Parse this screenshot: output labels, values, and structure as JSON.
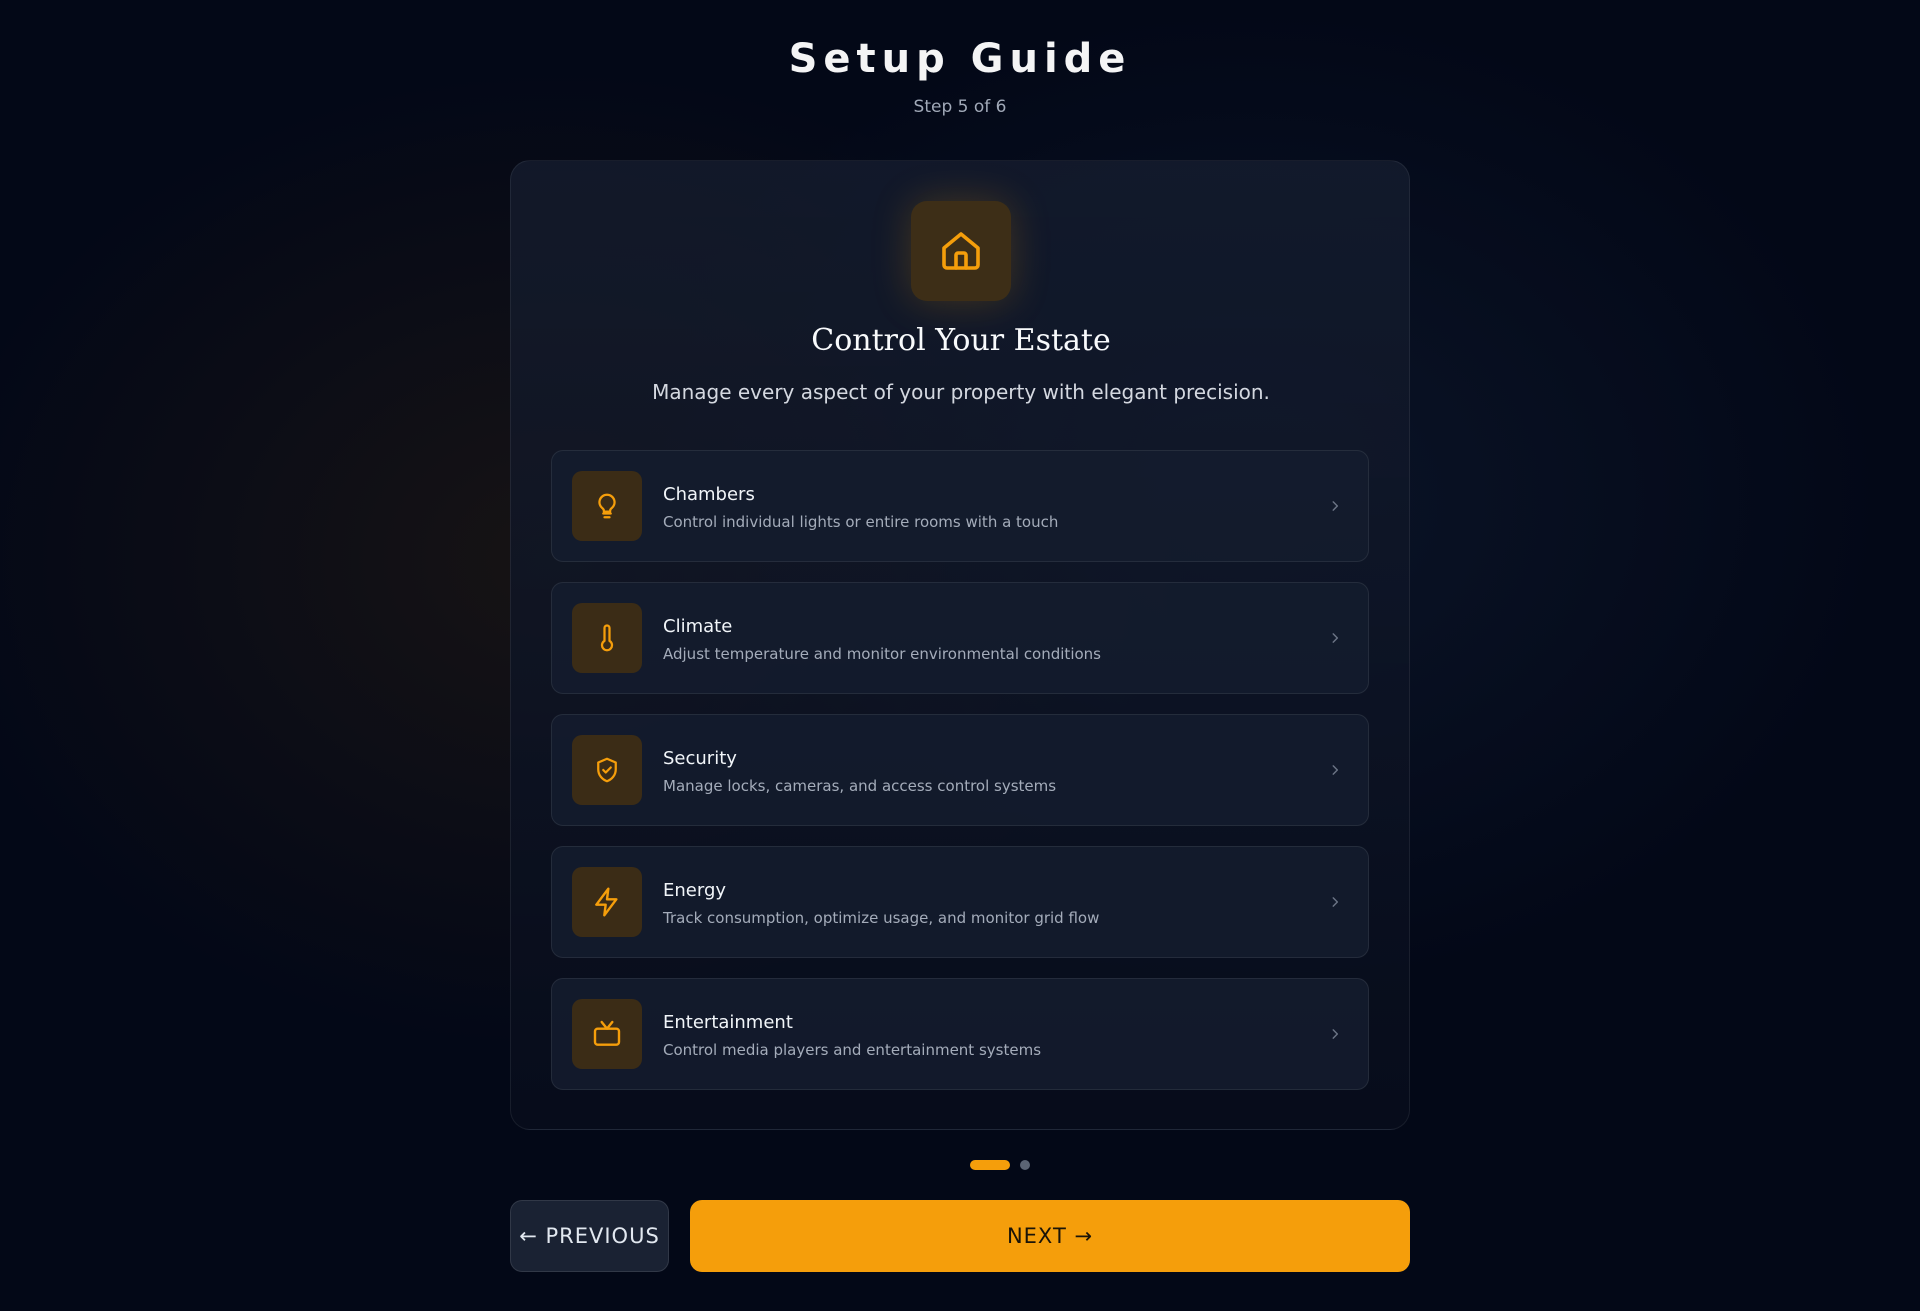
{
  "header": {
    "title": "Setup Guide",
    "step": "Step 5 of 6"
  },
  "card": {
    "hero_icon": "home-icon",
    "title": "Control Your Estate",
    "description": "Manage every aspect of your property with elegant precision.",
    "features": [
      {
        "icon": "lightbulb-icon",
        "name": "Chambers",
        "description": "Control individual lights or entire rooms with a touch"
      },
      {
        "icon": "thermometer-icon",
        "name": "Climate",
        "description": "Adjust temperature and monitor environmental conditions"
      },
      {
        "icon": "shield-check-icon",
        "name": "Security",
        "description": "Manage locks, cameras, and access control systems"
      },
      {
        "icon": "lightning-icon",
        "name": "Energy",
        "description": "Track consumption, optimize usage, and monitor grid flow"
      },
      {
        "icon": "tv-icon",
        "name": "Entertainment",
        "description": "Control media players and entertainment systems"
      }
    ]
  },
  "pagination": {
    "active_index": 0,
    "count": 2
  },
  "nav": {
    "previous_label": "← PREVIOUS",
    "next_label": "NEXT →"
  },
  "colors": {
    "accent": "#f59e0b",
    "background": "#030817",
    "icon_tile": "#3b2c16"
  }
}
